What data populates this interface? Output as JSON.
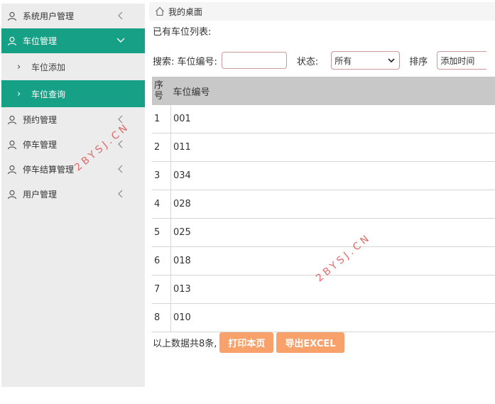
{
  "sidebar": {
    "items": [
      {
        "label": "系统用户管理",
        "active": false
      },
      {
        "label": "车位管理",
        "active": true
      },
      {
        "label": "车位添加",
        "sub": true,
        "active": false
      },
      {
        "label": "车位查询",
        "sub": true,
        "active": true
      },
      {
        "label": "预约管理",
        "active": false
      },
      {
        "label": "停车管理",
        "active": false
      },
      {
        "label": "停车结算管理",
        "active": false
      },
      {
        "label": "用户管理",
        "active": false
      }
    ]
  },
  "breadcrumb": {
    "label": "我的桌面"
  },
  "main": {
    "list_title": "已有车位列表:",
    "search": {
      "label": "搜索: 车位编号:",
      "input_value": "",
      "status_label": "状态:",
      "status_selected": "所有",
      "sort_label": "排序",
      "sort_selected": "添加时间"
    },
    "table": {
      "headers": [
        "序号",
        "车位编号"
      ],
      "rows": [
        [
          "1",
          "001"
        ],
        [
          "2",
          "011"
        ],
        [
          "3",
          "034"
        ],
        [
          "4",
          "028"
        ],
        [
          "5",
          "025"
        ],
        [
          "6",
          "018"
        ],
        [
          "7",
          "013"
        ],
        [
          "8",
          "010"
        ]
      ]
    },
    "footer": {
      "summary": "以上数据共8条,",
      "print_button": "打印本页",
      "export_button": "导出EXCEL"
    }
  },
  "watermark": "2BYSJ.CN",
  "colors": {
    "accent": "#16a085",
    "button": "#f8a16b",
    "header_bg": "#c8c8c8"
  }
}
